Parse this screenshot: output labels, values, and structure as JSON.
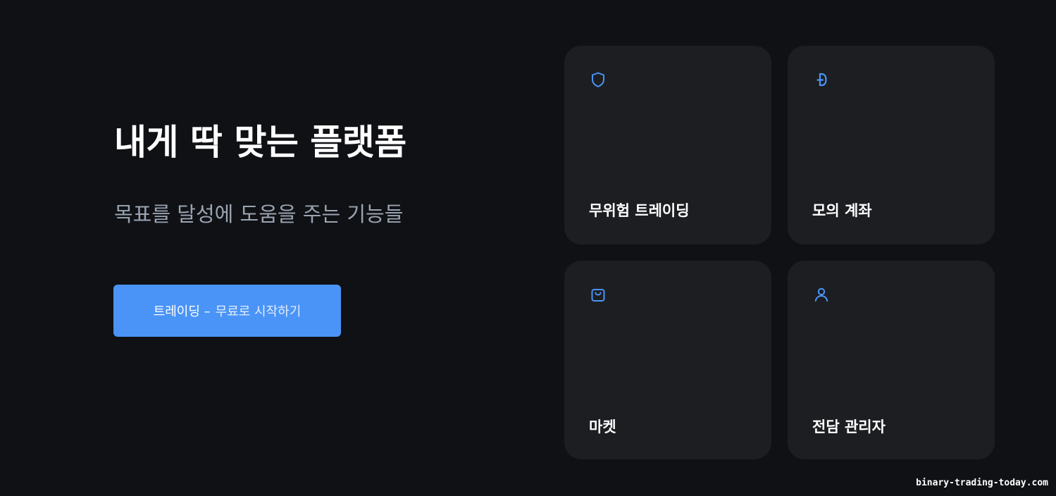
{
  "hero": {
    "title": "내게 딱 맞는 플랫폼",
    "subtitle": "목표를 달성에 도움을 주는 기능들",
    "cta_primary": "트레이딩 –",
    "cta_secondary": "무료로 시작하기"
  },
  "features": [
    {
      "label": "무위험 트레이딩",
      "icon": "shield-icon"
    },
    {
      "label": "모의 계좌",
      "icon": "currency-icon"
    },
    {
      "label": "마켓",
      "icon": "shopping-bag-icon"
    },
    {
      "label": "전담 관리자",
      "icon": "user-icon"
    }
  ],
  "watermark": "binary-trading-today.com",
  "colors": {
    "background": "#101115",
    "card": "#1d1e22",
    "accent": "#4a94f8",
    "subtitle": "#9aa4b2"
  }
}
